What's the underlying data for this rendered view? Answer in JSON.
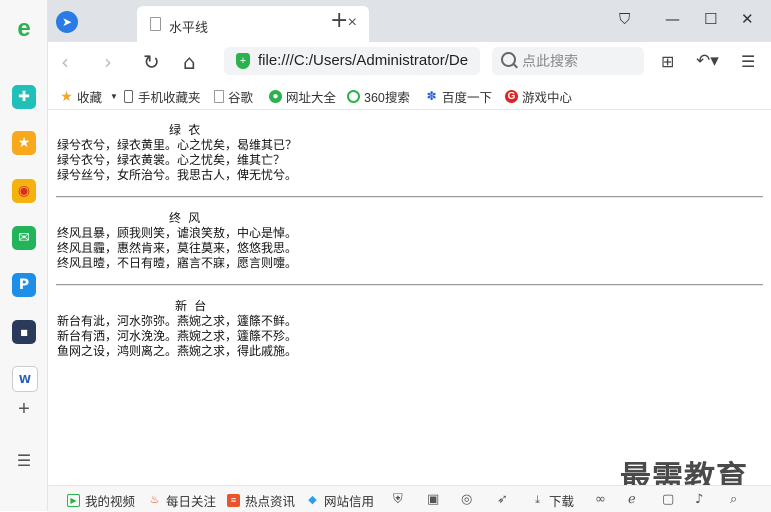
{
  "tab": {
    "title": "水平线"
  },
  "address": {
    "url": "file:///C:/Users/Administrator/De"
  },
  "search": {
    "placeholder": "点此搜索"
  },
  "bookmarks": [
    {
      "label": "收藏",
      "icon": "star-icon",
      "color": "#f5a623"
    },
    {
      "label": "手机收藏夹",
      "icon": "phone-icon",
      "color": "#666666"
    },
    {
      "label": "谷歌",
      "icon": "page-icon",
      "color": "#999999"
    },
    {
      "label": "网址大全",
      "icon": "globe-icon",
      "color": "#2bb24c"
    },
    {
      "label": "360搜索",
      "icon": "search-360-icon",
      "color": "#2bb24c"
    },
    {
      "label": "百度一下",
      "icon": "paw-icon",
      "color": "#3366cc"
    },
    {
      "label": "游戏中心",
      "icon": "game-icon",
      "color": "#e02424"
    }
  ],
  "poems": [
    {
      "title": "绿 衣",
      "lines": [
        "绿兮衣兮，绿衣黄里。心之忧矣，曷维其已？",
        "绿兮衣兮，绿衣黄裳。心之忧矣，维其亡？",
        "绿兮丝兮，女所治兮。我思古人，俾无忧兮。"
      ]
    },
    {
      "title": "终 风",
      "lines": [
        "终风且暴，顾我则笑，谑浪笑敖，中心是悼。",
        "终风且霾，惠然肯来，莫往莫来，悠悠我思。",
        "终风且曀，不日有曀，寤言不寐，愿言则嚏。"
      ]
    },
    {
      "title": "新 台",
      "lines": [
        "新台有泚，河水弥弥。燕婉之求，籧篨不鲜。",
        "新台有洒，河水浼浼。燕婉之求，籧篨不殄。",
        "鱼网之设，鸿则离之。燕婉之求，得此戚施。"
      ]
    }
  ],
  "watermark": "最需教育",
  "statusbar": [
    {
      "label": "我的视频",
      "icon": "video-icon",
      "color": "#2bb24c"
    },
    {
      "label": "每日关注",
      "icon": "fire-icon",
      "color": "#e8542b"
    },
    {
      "label": "热点资讯",
      "icon": "news-icon",
      "color": "#e8542b"
    },
    {
      "label": "网站信用",
      "icon": "drop-icon",
      "color": "#2b9fe8"
    },
    {
      "label": "下载",
      "icon": "download-icon",
      "color": "#555555"
    }
  ]
}
